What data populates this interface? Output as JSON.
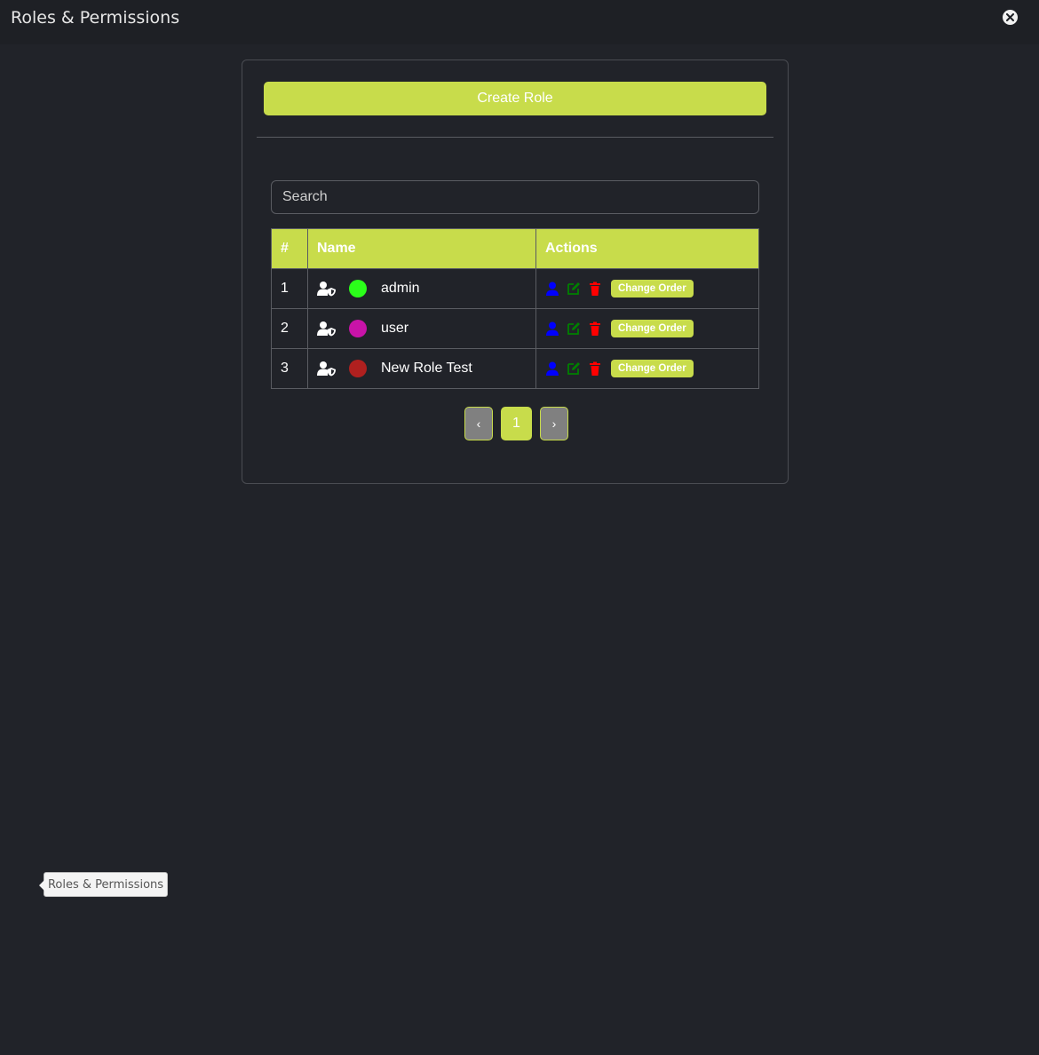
{
  "window": {
    "title": "Roles & Permissions"
  },
  "toolbar": {
    "create_label": "Create Role"
  },
  "search": {
    "placeholder": "Search"
  },
  "table": {
    "headers": [
      "#",
      "Name",
      "Actions"
    ],
    "rows": [
      {
        "num": "1",
        "name": "admin",
        "color": "#2bff1a",
        "order_label": "Change Order"
      },
      {
        "num": "2",
        "name": "user",
        "color": "#c813a8",
        "order_label": "Change Order"
      },
      {
        "num": "3",
        "name": "New Role Test",
        "color": "#b0201f",
        "order_label": "Change Order"
      }
    ],
    "row_icons": [
      "user-shield-icon",
      "user-icon",
      "edit-icon",
      "trash-icon"
    ]
  },
  "pagination": {
    "prev": "‹",
    "current": "1",
    "next": "›"
  },
  "tooltip": {
    "text": "Roles & Permissions"
  },
  "colors": {
    "accent": "#c8dc4b",
    "background": "#212329",
    "user_icon": "#0000ff",
    "edit_icon": "#008000",
    "trash_icon": "#ff0000"
  }
}
